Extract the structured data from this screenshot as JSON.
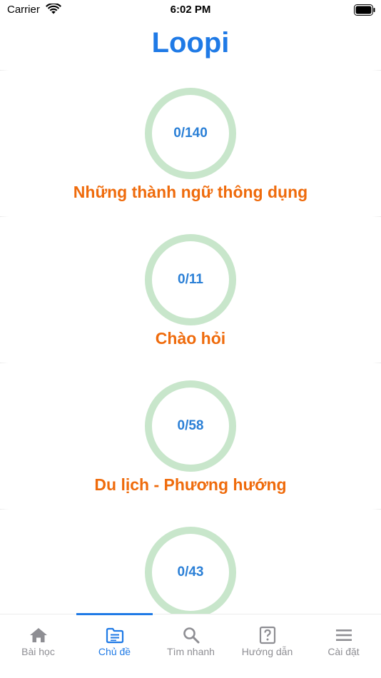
{
  "status_bar": {
    "carrier": "Carrier",
    "time": "6:02 PM",
    "icons": [
      "wifi-icon",
      "battery-icon"
    ]
  },
  "app": {
    "title": "Loopi",
    "accent_color": "#1f7ae6",
    "topic_color": "#ef6b0c",
    "ring_color": "#c8e6cb"
  },
  "topics": [
    {
      "progress": "0/140",
      "name": "Những thành ngữ thông dụng"
    },
    {
      "progress": "0/11",
      "name": "Chào hỏi"
    },
    {
      "progress": "0/58",
      "name": "Du lịch - Phương hướng"
    },
    {
      "progress": "0/43",
      "name": ""
    }
  ],
  "tab_bar": {
    "active_index": 1,
    "tabs": [
      {
        "label": "Bài học",
        "icon": "home-icon"
      },
      {
        "label": "Chủ đề",
        "icon": "topic-icon"
      },
      {
        "label": "Tìm nhanh",
        "icon": "search-icon"
      },
      {
        "label": "Hướng dẫn",
        "icon": "help-icon"
      },
      {
        "label": "Cài đặt",
        "icon": "menu-icon"
      }
    ]
  }
}
